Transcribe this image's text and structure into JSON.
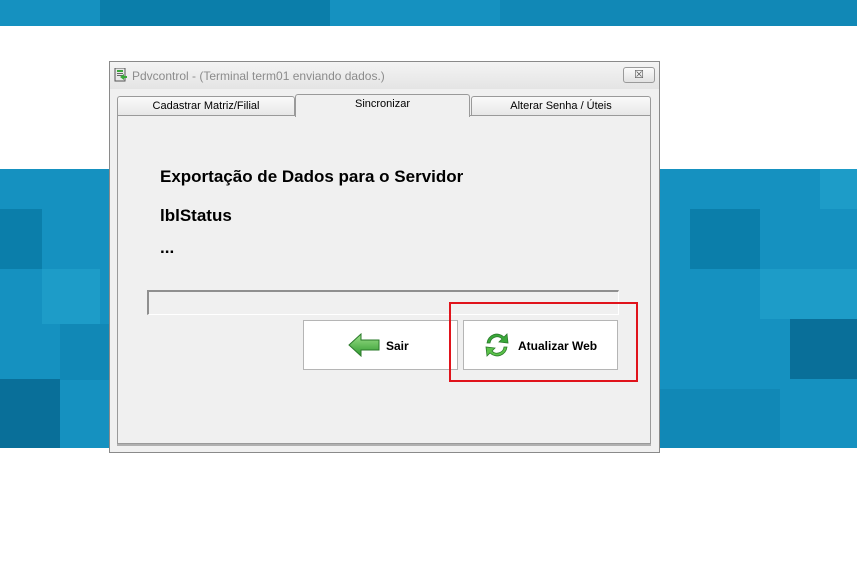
{
  "window": {
    "title": "Pdvcontrol - (Terminal term01 enviando dados.)",
    "close_label": "☒"
  },
  "tabs": [
    {
      "label": "Cadastrar Matriz/Filial",
      "active": false
    },
    {
      "label": "Sincronizar",
      "active": true
    },
    {
      "label": "Alterar Senha / Úteis",
      "active": false
    }
  ],
  "content": {
    "heading": "Exportação de Dados para o Servidor",
    "status": "lblStatus",
    "dots": "...",
    "progress": 0
  },
  "buttons": {
    "sair_label": "Sair",
    "web_label": "Atualizar Web"
  },
  "icons": {
    "app": "pdvcontrol-app-icon",
    "sair": "green-arrow-left-icon",
    "web": "green-refresh-icon"
  },
  "colors": {
    "background_blue": "#1591c0",
    "highlight_red": "#e0131b",
    "icon_green": "#3aa83a"
  }
}
